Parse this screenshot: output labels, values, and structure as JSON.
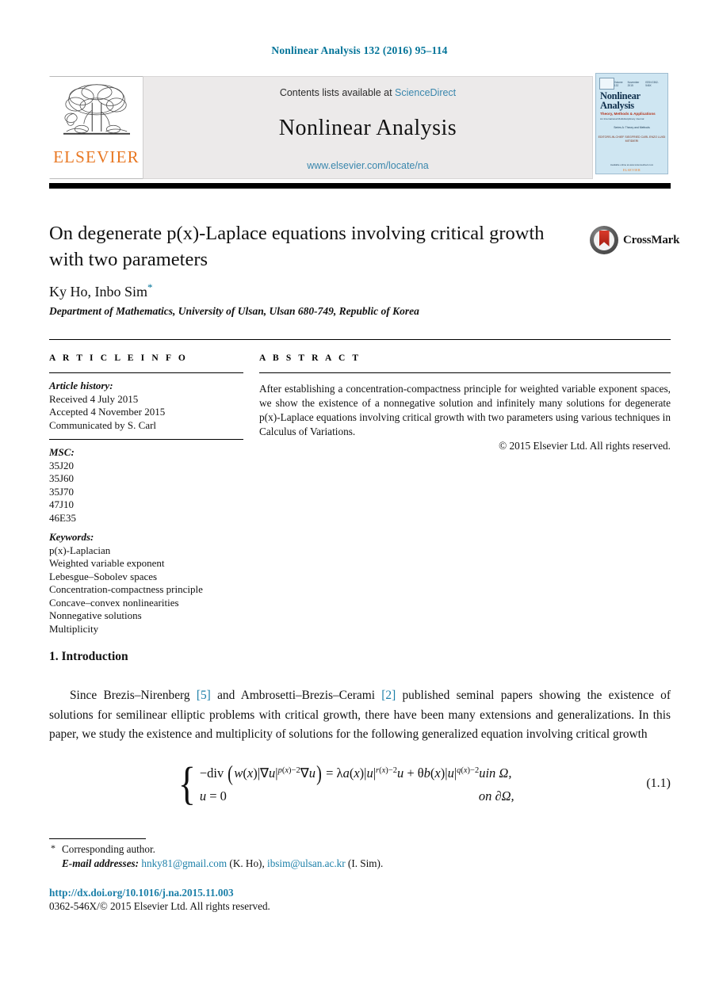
{
  "running_head": "Nonlinear Analysis 132 (2016) 95–114",
  "masthead": {
    "publisher_name": "ELSEVIER",
    "contents_prefix": "Contents lists available at ",
    "sciencedirect": "ScienceDirect",
    "journal_name": "Nonlinear Analysis",
    "journal_url": "www.elsevier.com/locate/na",
    "cover": {
      "vol_left": "Volume 132",
      "vol_mid": "November 2015",
      "vol_right": "ISSN 0362-546X",
      "title": "Nonlinear Analysis",
      "subtitle": "Theory, Methods & Applications",
      "subtitle2": "An International Multidisciplinary Journal",
      "series": "Series A: Theory and Methods",
      "editors": "EDITORS-IN-CHIEF\nSIEGFRIED CARL\nENZO LUIGI MITIDIERI",
      "footer": "Available online at www.sciencedirect.com",
      "logo": "ELSEVIER"
    }
  },
  "article": {
    "title_line1": "On degenerate p(x)-Laplace equations involving critical growth",
    "title_line2": "with two parameters",
    "crossmark_label": "CrossMark",
    "authors": "Ky Ho, Inbo Sim",
    "corresponding_marker": "*",
    "affiliation": "Department of Mathematics, University of Ulsan, Ulsan 680-749, Republic of Korea"
  },
  "info": {
    "heading": "A R T I C L E   I N F O",
    "history_label": "Article history:",
    "history": [
      "Received 4 July 2015",
      "Accepted 4 November 2015",
      "Communicated by S. Carl"
    ],
    "msc_label": "MSC:",
    "msc": [
      "35J20",
      "35J60",
      "35J70",
      "47J10",
      "46E35"
    ],
    "keywords_label": "Keywords:",
    "keywords": [
      "p(x)-Laplacian",
      "Weighted variable exponent",
      "Lebesgue–Sobolev spaces",
      "Concentration-compactness principle",
      "Concave–convex nonlinearities",
      "Nonnegative solutions",
      "Multiplicity"
    ]
  },
  "abstract": {
    "heading": "A B S T R A C T",
    "body": "After establishing a concentration-compactness principle for weighted variable exponent spaces, we show the existence of a nonnegative solution and infinitely many solutions for degenerate p(x)-Laplace equations involving critical growth with two parameters using various techniques in Calculus of Variations.",
    "copyright": "© 2015 Elsevier Ltd. All rights reserved."
  },
  "introduction": {
    "section_title": "1. Introduction",
    "paragraph_part1": "Since Brezis–Nirenberg ",
    "citation1": "[5]",
    "paragraph_part2": " and Ambrosetti–Brezis–Cerami ",
    "citation2": "[2]",
    "paragraph_part3": " published seminal papers showing the existence of solutions for semilinear elliptic problems with critical growth, there have been many extensions and generalizations. In this paper, we study the existence and multiplicity of solutions for the following generalized equation involving critical growth"
  },
  "equation": {
    "number": "(1.1)",
    "line1_condition": "in Ω,",
    "line2_condition": "on ∂Ω,"
  },
  "footnotes": {
    "corresponding_marker": "*",
    "corresponding": "Corresponding author.",
    "email_label": "E-mail addresses:",
    "email1": "hnky81@gmail.com",
    "email1_owner": "(K. Ho),",
    "email2": "ibsim@ulsan.ac.kr",
    "email2_owner": "(I. Sim).",
    "doi": "http://dx.doi.org/10.1016/j.na.2015.11.003",
    "issn_line": "0362-546X/© 2015 Elsevier Ltd. All rights reserved."
  },
  "colors": {
    "link": "#1b7fa8",
    "running_head": "#007398",
    "elsevier_orange": "#e87722",
    "banner_bg": "#eceaea"
  }
}
